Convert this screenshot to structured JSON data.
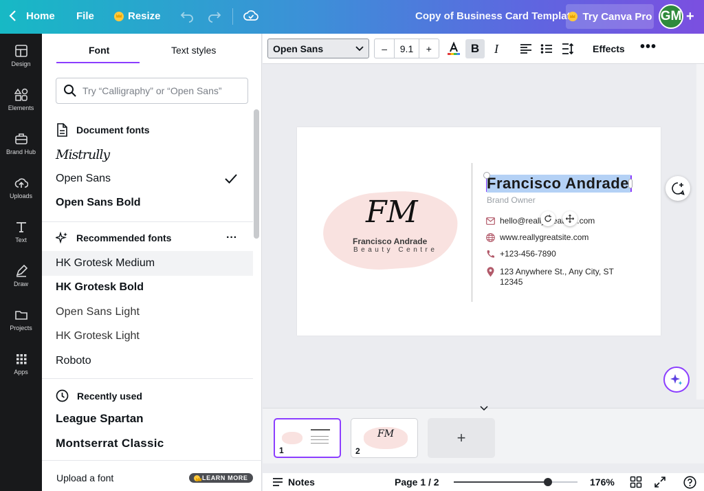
{
  "topbar": {
    "home": "Home",
    "file": "File",
    "resize": "Resize",
    "title": "Copy of Business Card Template",
    "pro": "Try Canva Pro",
    "avatar": "GM"
  },
  "rail": [
    {
      "label": "Design",
      "icon": "layout-icon"
    },
    {
      "label": "Elements",
      "icon": "shapes-icon"
    },
    {
      "label": "Brand Hub",
      "icon": "briefcase-icon"
    },
    {
      "label": "Uploads",
      "icon": "cloud-upload-icon"
    },
    {
      "label": "Text",
      "icon": "text-icon"
    },
    {
      "label": "Draw",
      "icon": "pen-icon"
    },
    {
      "label": "Projects",
      "icon": "folder-icon"
    },
    {
      "label": "Apps",
      "icon": "grid-icon"
    }
  ],
  "panel": {
    "tab_font": "Font",
    "tab_styles": "Text styles",
    "search_placeholder": "Try “Calligraphy” or “Open Sans”",
    "doc_header": "Document fonts",
    "doc_fonts": [
      "Mistrully",
      "Open Sans",
      "Open Sans Bold"
    ],
    "rec_header": "Recommended fonts",
    "rec_fonts": [
      "HK Grotesk Medium",
      "HK Grotesk Bold",
      "Open Sans Light",
      "HK Grotesk Light",
      "Roboto"
    ],
    "recent_header": "Recently used",
    "recent_fonts": [
      "League Spartan",
      "Montserrat Classic"
    ],
    "upload": "Upload a font",
    "learn": "LEARN MORE"
  },
  "toolbar": {
    "font": "Open Sans",
    "size_minus": "–",
    "size": "9.1",
    "size_plus": "+",
    "bold": "B",
    "italic": "I",
    "effects": "Effects",
    "more": "•••"
  },
  "card": {
    "monogram": "FM",
    "logo_name": "Francisco Andrade",
    "logo_sub": "Beauty Centre",
    "name": "Francisco Andrade",
    "role": "Brand Owner",
    "email": "hello@reallygreatsite.com",
    "web": "www.reallygreatsite.com",
    "phone": "+123-456-7890",
    "addr1": "123 Anywhere St., Any City, ST",
    "addr2": "12345"
  },
  "pages": {
    "thumb1_num": "1",
    "thumb2_num": "2",
    "add": "+"
  },
  "status": {
    "notes": "Notes",
    "page": "Page 1 / 2",
    "zoom": "176%",
    "zoom_level": 0.76
  },
  "colors": {
    "accent": "#8b3dff",
    "brush": "#f9e2e0",
    "selection": "#b4d1f5"
  }
}
